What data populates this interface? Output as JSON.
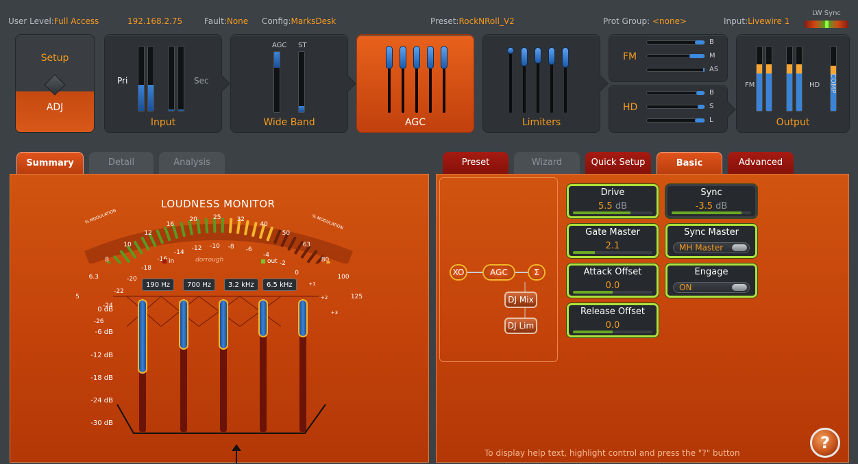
{
  "status": {
    "user_level_label": "User Level:",
    "user_level": "Full Access",
    "ip": "192.168.2.75",
    "fault_label": "Fault:",
    "fault": "None",
    "config_label": "Config:",
    "config": "MarksDesk",
    "preset_label": "Preset:",
    "preset": "RockNRoll_V2",
    "prot_group_label": "Prot Group:",
    "prot_group": "<none>",
    "input_label": "Input:",
    "input": "Livewire 1",
    "lw_sync_label": "LW Sync"
  },
  "modules": {
    "setup_top": "Setup",
    "setup_bottom": "ADJ",
    "input_label": "Input",
    "input_pri": "Pri",
    "input_sec": "Sec",
    "wideband_label": "Wide Band",
    "wideband_agc": "AGC",
    "wideband_st": "ST",
    "agc_label": "AGC",
    "limiters_label": "Limiters",
    "fm_label": "FM",
    "fm_bands": [
      "B",
      "M",
      "AS"
    ],
    "hd_label": "HD",
    "hd_bands": [
      "B",
      "S",
      "L"
    ],
    "output_label": "Output",
    "output_fm": "FM",
    "output_hd": "HD",
    "output_comp": "COMP"
  },
  "left_tabs": [
    "Summary",
    "Detail",
    "Analysis"
  ],
  "right_tabs": [
    "Preset",
    "Wizard",
    "Quick Setup",
    "Basic",
    "Advanced"
  ],
  "loudness": {
    "title": "LOUDNESS MONITOR",
    "mod_left": "% MODULATION",
    "mod_right": "% MODULATION",
    "mod_scale": [
      "5",
      "6.3",
      "8",
      "10",
      "12",
      "16",
      "20",
      "25",
      "32",
      "40",
      "50",
      "63",
      "80",
      "100",
      "125"
    ],
    "db_scale": [
      "-26",
      "-24",
      "-22",
      "-20",
      "-18",
      "-16",
      "-14",
      "-12",
      "-10",
      "-8",
      "-6",
      "-4",
      "-2",
      "0",
      "+1",
      "+2",
      "+3"
    ],
    "in_label": "in",
    "out_label": "out",
    "brand": "dorrough"
  },
  "bands": [
    "190 Hz",
    "700 Hz",
    "3.2 kHz",
    "6.5 kHz"
  ],
  "db_levels": [
    "0 dB",
    "-6 dB",
    "-12 dB",
    "-18 dB",
    "-24 dB",
    "-30 dB"
  ],
  "agc_gain_fraction": [
    0.56,
    0.38,
    0.38,
    0.29,
    0.29
  ],
  "flow": {
    "xo": "XO",
    "agc": "AGC",
    "sum": "Σ",
    "dj_mix": "DJ Mix",
    "dj_lim": "DJ Lim"
  },
  "controls": {
    "drive": {
      "name": "Drive",
      "value": "5.5",
      "unit": "dB",
      "level": 0.72
    },
    "sync": {
      "name": "Sync",
      "value": "-3.5",
      "unit": "dB",
      "level": 0.88
    },
    "gate_master": {
      "name": "Gate Master",
      "value": "2.1",
      "level": 0.28
    },
    "sync_master": {
      "name": "Sync Master",
      "value": "MH Master"
    },
    "attack_offset": {
      "name": "Attack Offset",
      "value": "0.0",
      "level": 0.5
    },
    "engage": {
      "name": "Engage",
      "value": "ON"
    },
    "release_offset": {
      "name": "Release Offset",
      "value": "0.0",
      "level": 0.5
    }
  },
  "help": {
    "text": "To display help text, highlight control and press the \"?\" button",
    "button": "?"
  }
}
